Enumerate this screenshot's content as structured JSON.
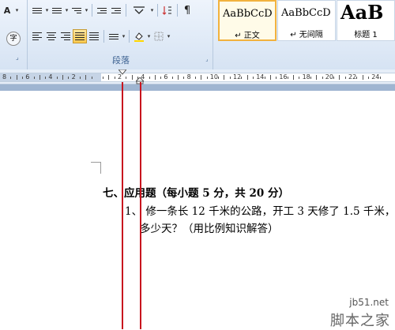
{
  "ribbon": {
    "styles": {
      "items": [
        {
          "sample": "AaBbCcD",
          "name": "↵ 正文",
          "selected": true
        },
        {
          "sample": "AaBbCcD",
          "name": "↵ 无间隔",
          "selected": false
        },
        {
          "sample": "AaB",
          "name": "标题 1",
          "selected": false
        }
      ]
    },
    "paragraph_group": {
      "label": "段落"
    },
    "circle_button": "字"
  },
  "ruler": {
    "labels": [
      "8",
      "6",
      "4",
      "2",
      "",
      "2",
      "4",
      "6",
      "8",
      "10",
      "12",
      "14",
      "16",
      "18",
      "20",
      "22",
      "24"
    ]
  },
  "document": {
    "heading": "七、应用题（每小题 5 分，共 20 分）",
    "question_line1": "1、 修一条长 12 千米的公路，开工 3 天修了 1.5 千米，",
    "question_line2": "多少天？（用比例知识解答）"
  },
  "watermark": {
    "site": "jb51.net",
    "name": "脚本之家"
  },
  "colors": {
    "annotation_line": "#c8141e",
    "active_button": "#ffc94d",
    "workspace": "#9fb5d1"
  }
}
